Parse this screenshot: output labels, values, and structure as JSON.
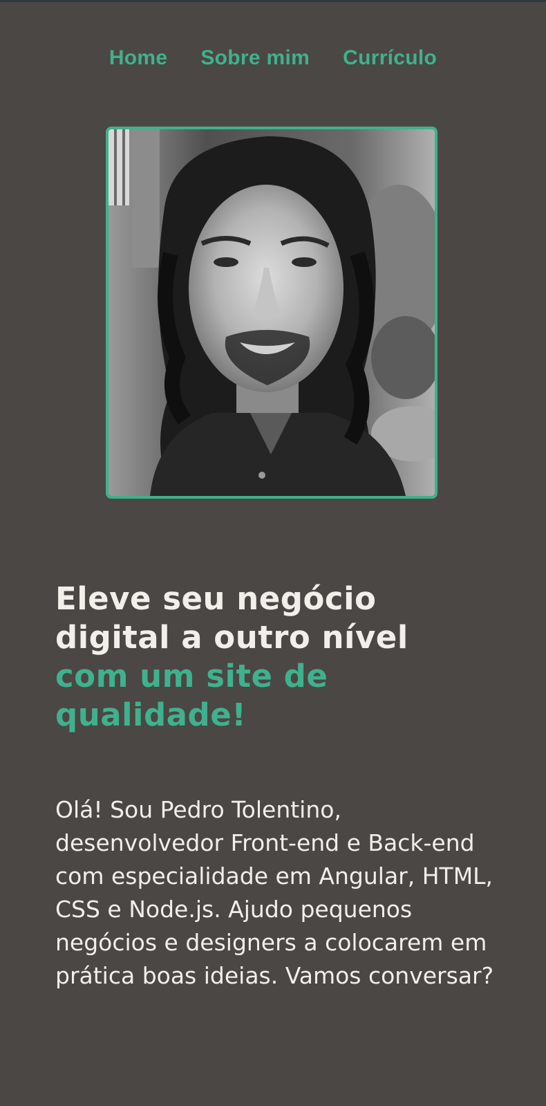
{
  "nav": {
    "items": [
      {
        "label": "Home"
      },
      {
        "label": "Sobre mim"
      },
      {
        "label": "Currículo"
      }
    ]
  },
  "hero": {
    "photo_alt": "Foto de Pedro Tolentino",
    "headline_line1": "Eleve seu negócio",
    "headline_line2": "digital a outro nível",
    "headline_accent_line1": "com um site de",
    "headline_accent_line2": "qualidade!",
    "bio": "Olá! Sou Pedro Tolentino, desenvolvedor Front-end e Back-end com especialidade em Angular, HTML, CSS e Node.js. Ajudo pequenos negócios e designers a colocarem em prática boas ideias. Vamos conversar?"
  },
  "colors": {
    "background": "#4b4744",
    "accent": "#3fb18e",
    "text": "#f2efea"
  }
}
